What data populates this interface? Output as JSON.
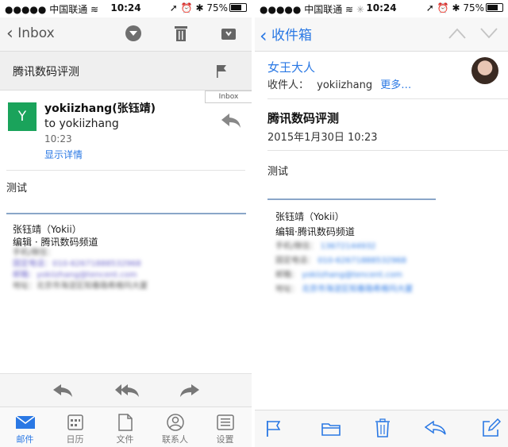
{
  "status_left": {
    "signal": "●●●●●",
    "carrier": "中国联通",
    "time": "10:24",
    "battery": "75%"
  },
  "status_right": {
    "signal": "●●●●●",
    "carrier": "中国联通",
    "time": "10:24",
    "battery": "75%"
  },
  "left": {
    "nav": {
      "back_label": "Inbox"
    },
    "subject": "腾讯数码评测",
    "folder_tag": "Inbox",
    "avatar_letter": "Y",
    "sender": "yokiizhang(张钰靖)",
    "to": "to yokiizhang",
    "time": "10:23",
    "show_details": "显示详情",
    "body": "测试",
    "sig_name": "张钰靖（Yokii）",
    "sig_title": "编辑 · 腾讯数码频道",
    "sig_blur": [
      "手机/微信：",
      "固定电话：010-62671888532968",
      "邮箱：yokiizhang@tencent.com",
      "地址：北京市海淀区知春路希格玛大厦"
    ],
    "tabs": [
      "邮件",
      "日历",
      "文件",
      "联系人",
      "设置"
    ]
  },
  "right": {
    "nav": {
      "back_label": "收件箱"
    },
    "from": "女王大人",
    "to_label": "收件人：",
    "to_value": "yokiizhang",
    "more": "更多…",
    "subject": "腾讯数码评测",
    "date": "2015年1月30日 10:23",
    "body": "测试",
    "sig_name": "张钰靖（Yokii）",
    "sig_title": "编辑·腾讯数码频道",
    "sig_rows": [
      {
        "k": "手机/微信：",
        "v": "13672144932"
      },
      {
        "k": "固定电话：",
        "v": "010-62671888532968"
      },
      {
        "k": "邮箱：",
        "v": "yokiizhang@tencent.com"
      },
      {
        "k": "地址：",
        "v": "北京市海淀区知春路希格玛大厦"
      }
    ]
  },
  "colors": {
    "accent": "#2a78e4",
    "avatar": "#1aa35b"
  }
}
